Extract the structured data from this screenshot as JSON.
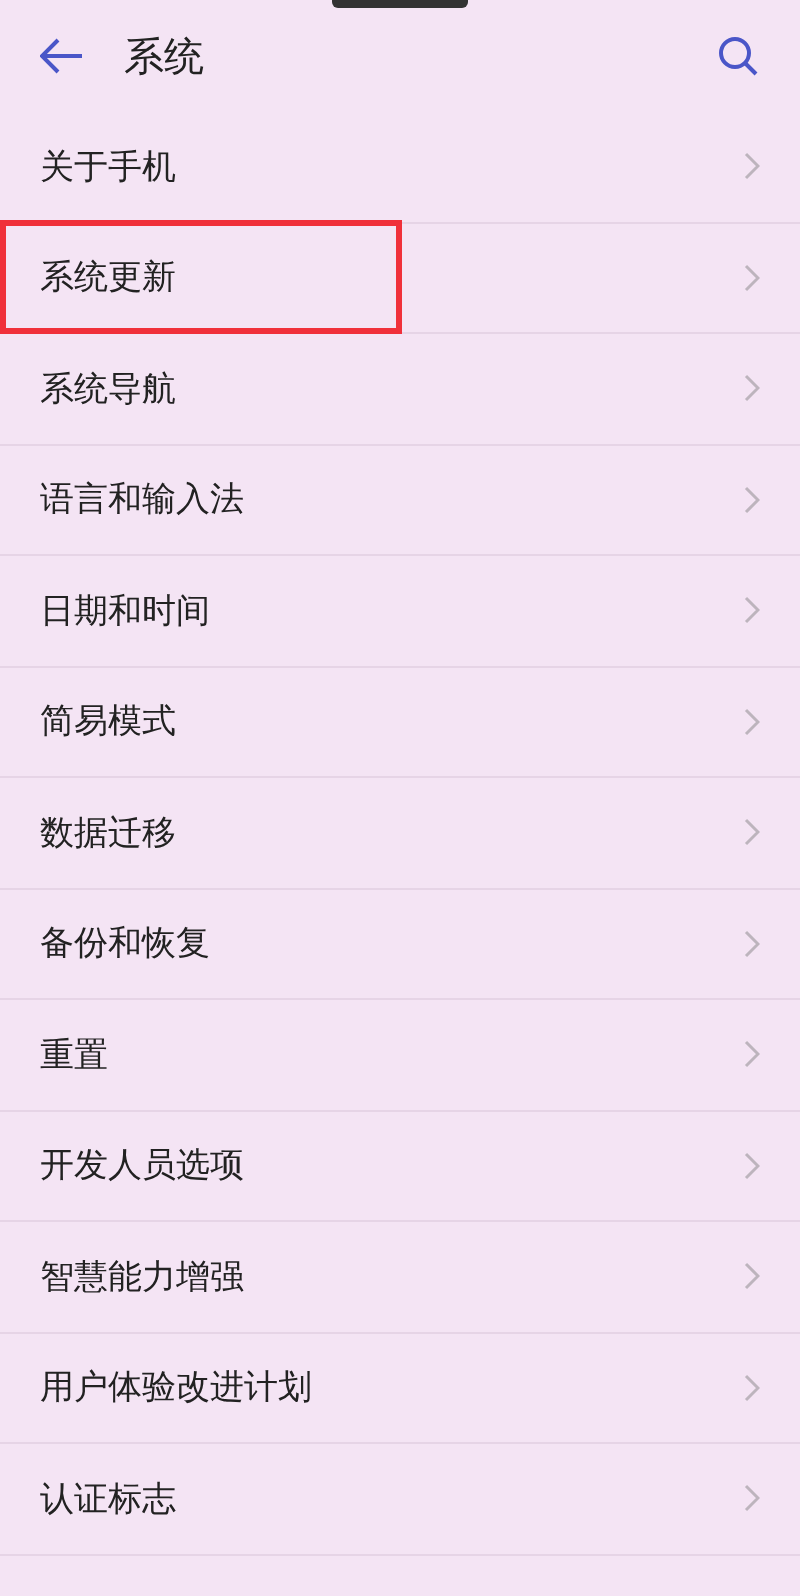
{
  "header": {
    "title": "系统"
  },
  "items": [
    {
      "label": "关于手机",
      "highlighted": false
    },
    {
      "label": "系统更新",
      "highlighted": true
    },
    {
      "label": "系统导航",
      "highlighted": false
    },
    {
      "label": "语言和输入法",
      "highlighted": false
    },
    {
      "label": "日期和时间",
      "highlighted": false
    },
    {
      "label": "简易模式",
      "highlighted": false
    },
    {
      "label": "数据迁移",
      "highlighted": false
    },
    {
      "label": "备份和恢复",
      "highlighted": false
    },
    {
      "label": "重置",
      "highlighted": false
    },
    {
      "label": "开发人员选项",
      "highlighted": false
    },
    {
      "label": "智慧能力增强",
      "highlighted": false
    },
    {
      "label": "用户体验改进计划",
      "highlighted": false
    },
    {
      "label": "认证标志",
      "highlighted": false
    }
  ]
}
